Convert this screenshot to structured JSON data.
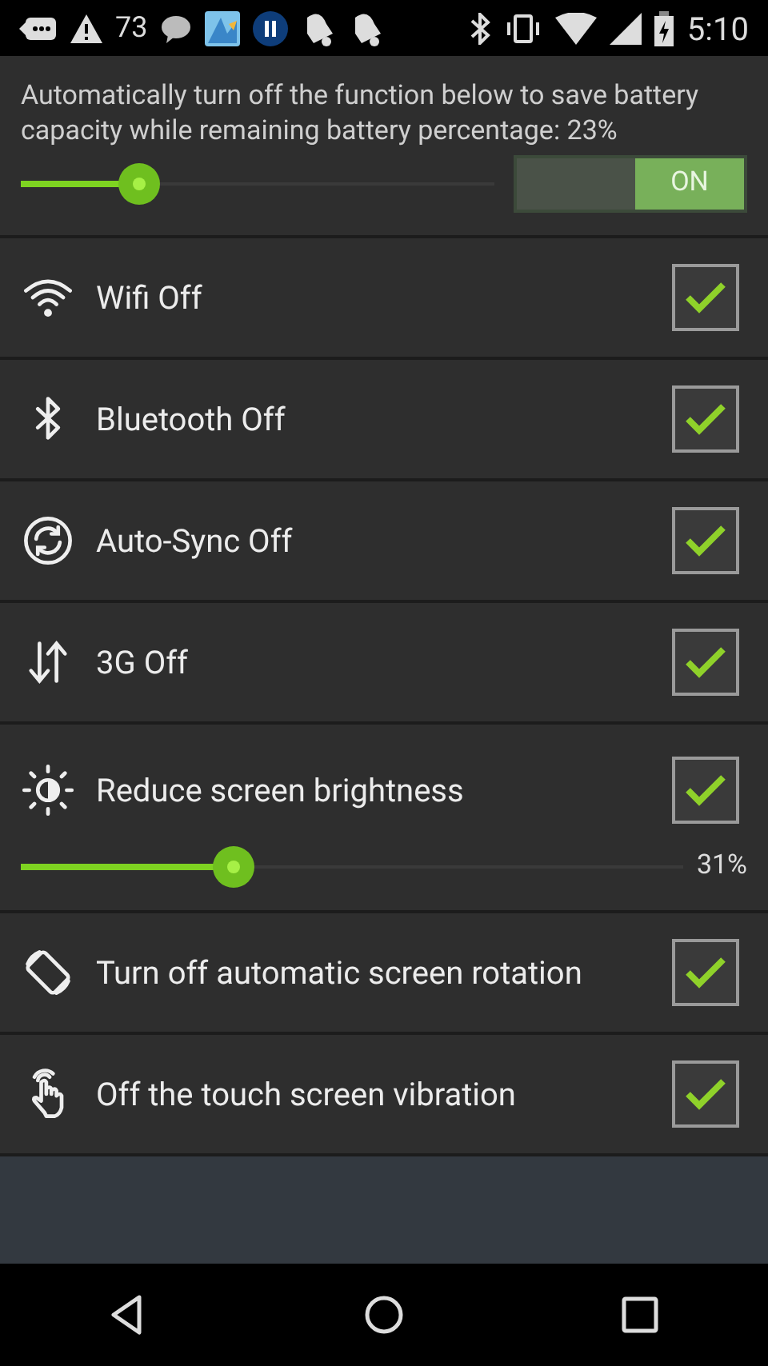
{
  "status_bar": {
    "notification_count": "73",
    "time": "5:10"
  },
  "header": {
    "description": "Automatically turn off the function below to save battery capacity while remaining battery percentage: 23%",
    "level": 0.25,
    "toggle": {
      "label": "ON",
      "on": true
    }
  },
  "items": [
    {
      "kind": "check",
      "label": "Wifi Off",
      "checked": true
    },
    {
      "kind": "check",
      "label": "Bluetooth Off",
      "checked": true
    },
    {
      "kind": "check",
      "label": "Auto-Sync Off",
      "checked": true
    },
    {
      "kind": "check",
      "label": "3G Off",
      "checked": true
    },
    {
      "kind": "slider",
      "label": "Reduce screen brightness",
      "checked": true,
      "level": 0.32,
      "reading": "31%"
    },
    {
      "kind": "check",
      "label": "Turn off automatic screen rotation",
      "checked": true
    },
    {
      "kind": "check",
      "label": "Off the touch screen vibration",
      "checked": true
    }
  ]
}
